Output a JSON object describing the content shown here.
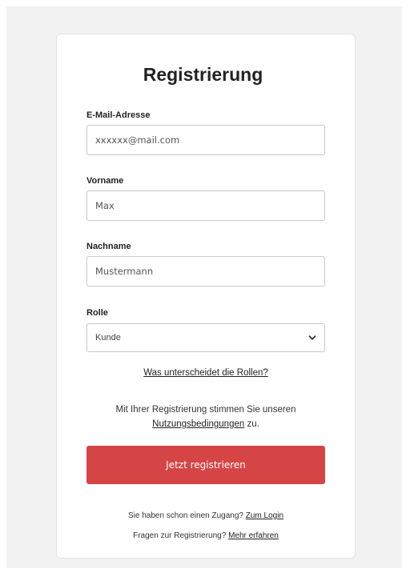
{
  "form": {
    "title": "Registrierung",
    "email": {
      "label": "E-Mail-Adresse",
      "value": "xxxxxx@mail.com"
    },
    "first_name": {
      "label": "Vorname",
      "value": "Max"
    },
    "last_name": {
      "label": "Nachname",
      "value": "Mustermann"
    },
    "role": {
      "label": "Rolle",
      "selected": "Kunde"
    },
    "roles_link": "Was unterscheidet die Rollen?",
    "terms": {
      "prefix": "Mit Ihrer Registrierung stimmen Sie unseren",
      "link": "Nutzungsbedingungen",
      "suffix": " zu."
    },
    "submit_label": "Jetzt registrieren",
    "login": {
      "question": "Sie haben schon einen Zugang? ",
      "link": "Zum Login"
    },
    "help": {
      "question": "Fragen zur Registrierung? ",
      "link": "Mehr erfahren"
    }
  },
  "icons": {
    "role_select": "chevron-down-icon"
  },
  "colors": {
    "primary_button": "#d64545",
    "page_background": "#f2f2f2",
    "card_background": "#ffffff"
  }
}
